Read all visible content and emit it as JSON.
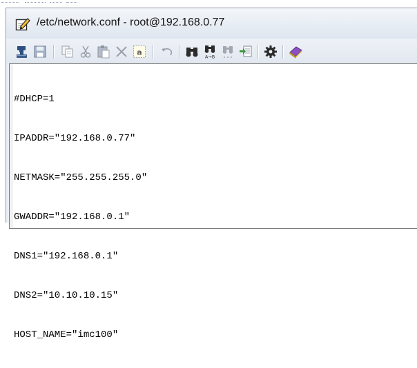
{
  "window": {
    "title": "/etc/network.conf - root@192.168.0.77",
    "title_icon": "notepad-pencil-icon"
  },
  "toolbar": {
    "buttons": [
      {
        "name": "ftp-upload-button",
        "icon": "ftp-transfer-icon"
      },
      {
        "name": "save-button",
        "icon": "floppy-disk-icon"
      },
      {
        "name": "copy-button",
        "icon": "copy-icon"
      },
      {
        "name": "cut-button",
        "icon": "scissors-icon"
      },
      {
        "name": "paste-button",
        "icon": "clipboard-icon"
      },
      {
        "name": "delete-button",
        "icon": "delete-x-icon"
      },
      {
        "name": "select-all-button",
        "icon": "select-all-icon"
      },
      {
        "name": "undo-button",
        "icon": "undo-arrow-icon"
      },
      {
        "name": "find-button",
        "icon": "binoculars-icon"
      },
      {
        "name": "replace-button",
        "icon": "binoculars-replace-icon"
      },
      {
        "name": "find-next-button",
        "icon": "binoculars-next-icon"
      },
      {
        "name": "go-to-line-button",
        "icon": "goto-page-icon"
      },
      {
        "name": "settings-button",
        "icon": "gear-icon"
      },
      {
        "name": "help-button",
        "icon": "help-book-icon"
      }
    ]
  },
  "editor": {
    "lines": [
      "#DHCP=1",
      "IPADDR=\"192.168.0.77\"",
      "NETMASK=\"255.255.255.0\"",
      "GWADDR=\"192.168.0.1\"",
      "DNS1=\"192.168.0.1\"",
      "DNS2=\"10.10.10.15\"",
      "HOST_NAME=\"imc100\""
    ]
  },
  "colors": {
    "title_bar": "#e9eef5",
    "editor_background": "#ffffff",
    "text": "#000000"
  }
}
